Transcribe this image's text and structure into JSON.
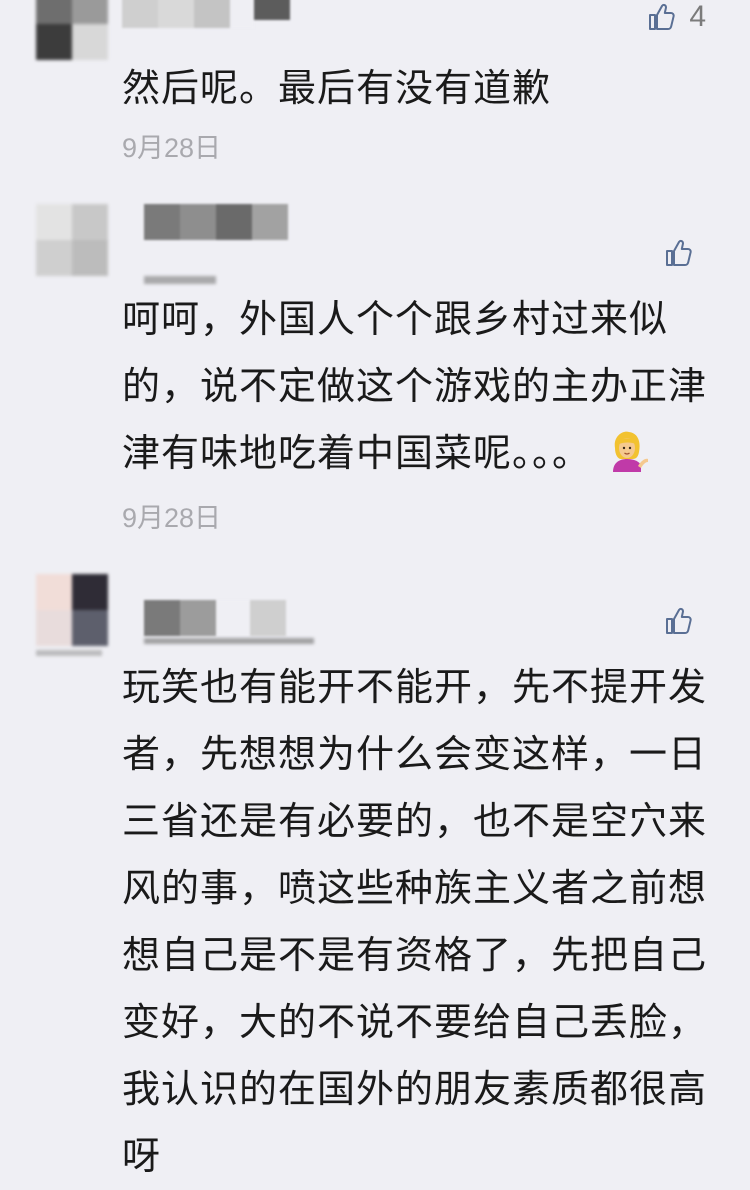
{
  "comments": [
    {
      "likes": "4",
      "text": "然后呢。最后有没有道歉",
      "date": "9月28日",
      "avatar_colors": [
        "#6e6e6e",
        "#9a9a9a",
        "#3c3c3c",
        "#d8d8d8"
      ],
      "name_colors": [
        "#cfcfcf",
        "#d9d9d9",
        "#c4c4c4",
        "#e4e4e4",
        "#5c5c5c"
      ]
    },
    {
      "likes": "",
      "text": "呵呵，外国人个个跟乡村过来似的，说不定做这个游戏的主办正津津有味地吃着中国菜呢。。。",
      "emoji": "person-tipping-hand",
      "date": "9月28日",
      "avatar_colors": [
        "#e3e3e3",
        "#c8c8c8",
        "#cfcfcf",
        "#bcbcbc"
      ],
      "name_colors": [
        "#7a7a7a",
        "#8e8e8e",
        "#6a6a6a",
        "#a2a2a2"
      ]
    },
    {
      "likes": "",
      "text": "玩笑也有能开不能开，先不提开发者，先想想为什么会变这样，一日三省还是有必要的，也不是空穴来风的事，喷这些种族主义者之前想想自己是不是有资格了，先把自己变好，大的不说不要给自己丢脸，我认识的在国外的朋友素质都很高呀",
      "date": "",
      "avatar_colors": [
        "#f1ddd8",
        "#2f2c36",
        "#e8dcdc",
        "#5d5f6c"
      ],
      "name_colors": [
        "#7a7a7a",
        "#9c9c9c",
        "#efeff4",
        "#cfcfcf"
      ]
    }
  ],
  "icons": {
    "like": "thumbs-up-icon"
  }
}
